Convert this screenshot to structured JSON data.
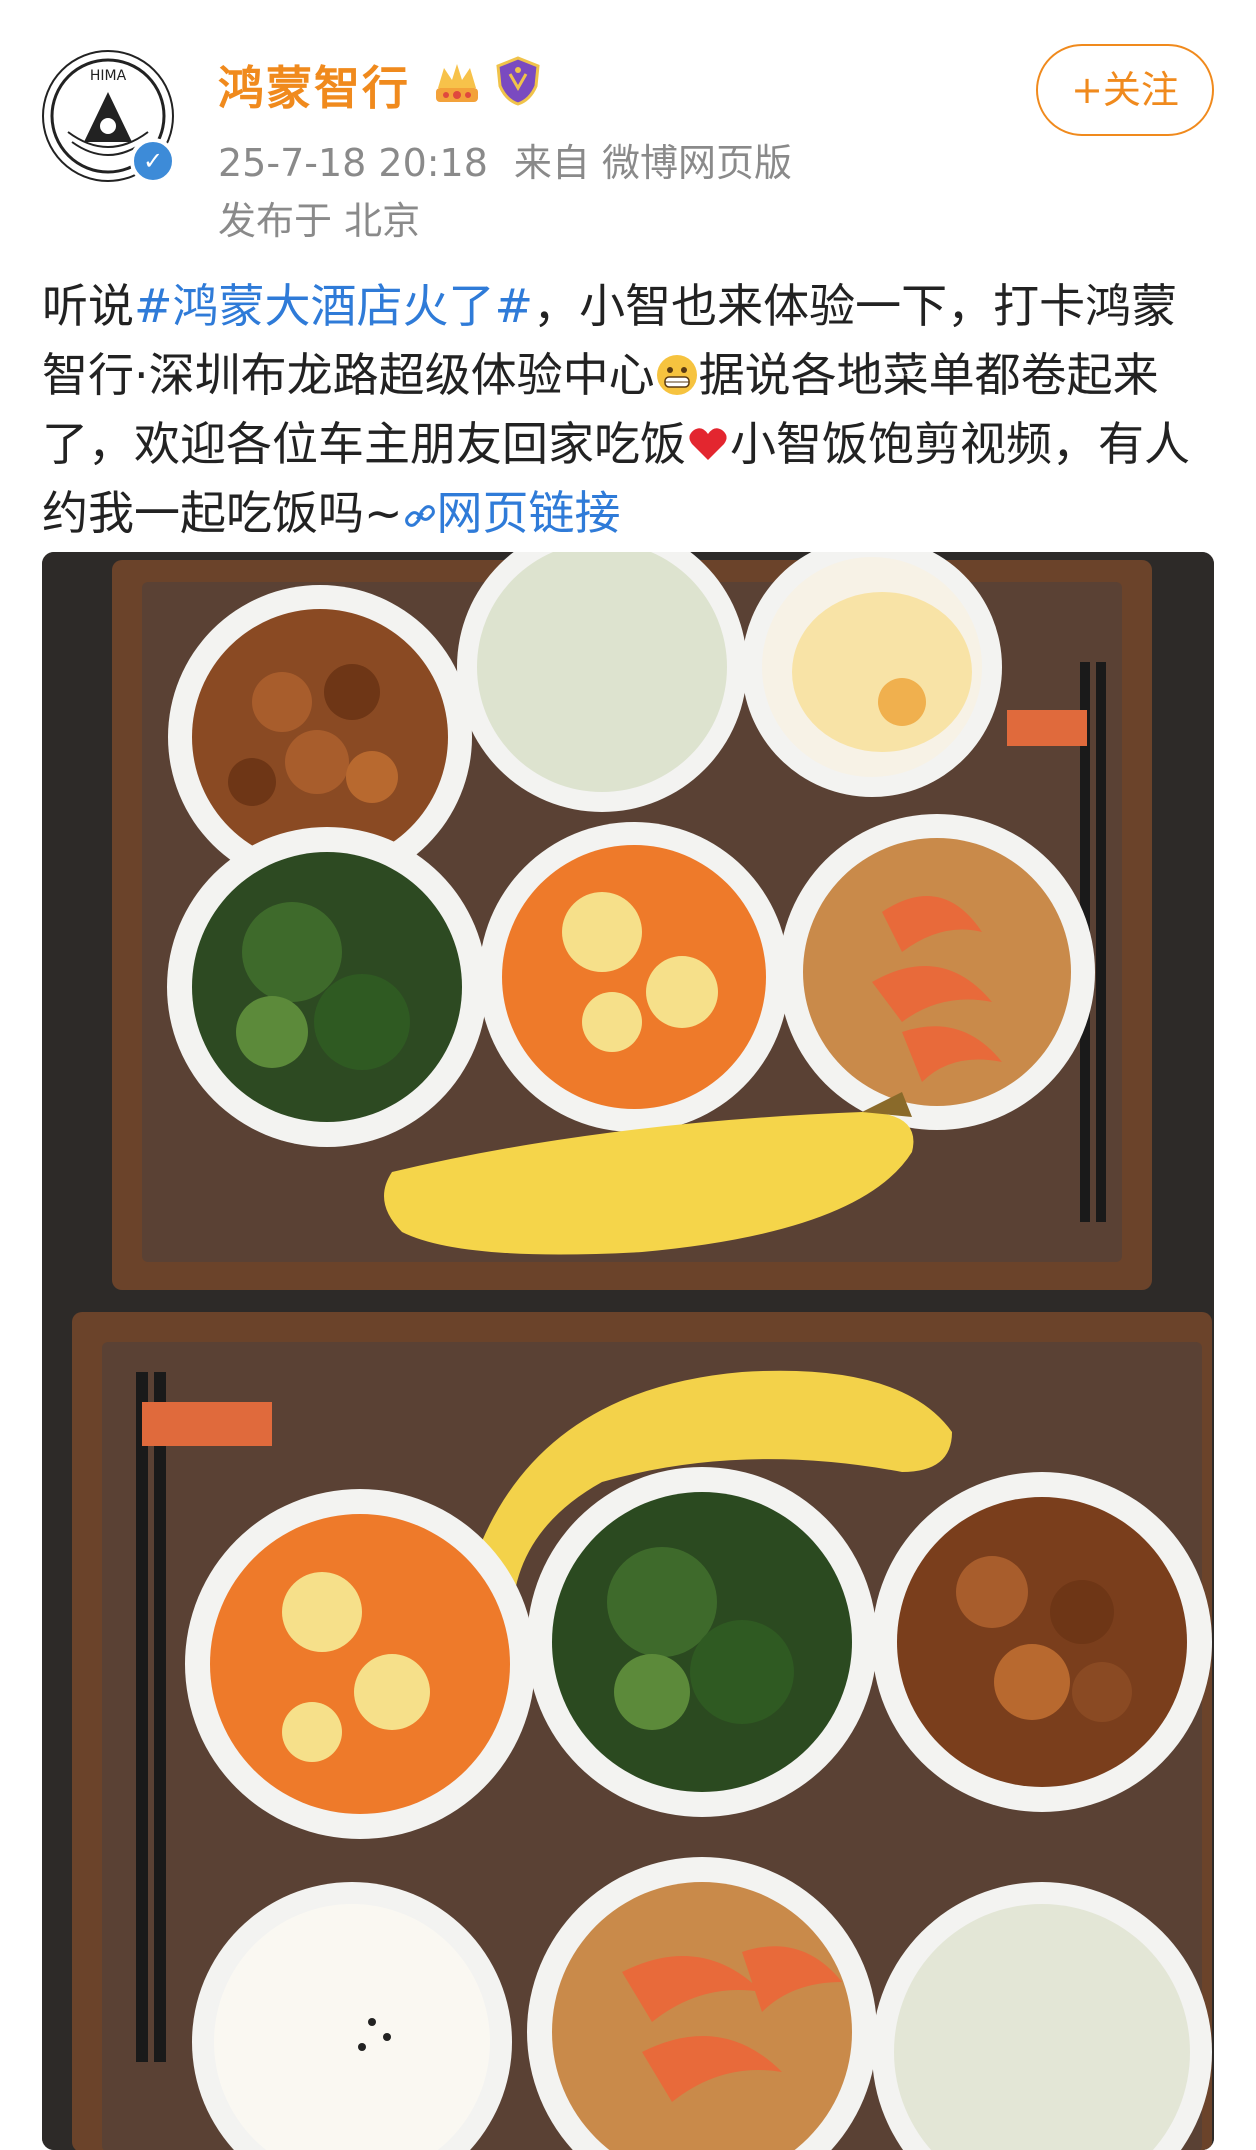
{
  "author": {
    "name": "鸿蒙智行",
    "avatar_text": "HIMA",
    "verified_icon": "verified-check-icon",
    "badges": [
      "crown-badge-icon",
      "shield-badge-icon"
    ]
  },
  "post_meta": {
    "timestamp": "25-7-18 20:18",
    "source": "来自 微博网页版",
    "location": "发布于 北京"
  },
  "follow_button": {
    "label": "+关注"
  },
  "post": {
    "text_1": "听说",
    "topic": "#鸿蒙大酒店火了#",
    "text_2": "，小智也来体验一下，打卡鸿蒙智行·深圳布龙路超级体验中心",
    "text_3": "据说各地菜单都卷起来了，欢迎各位车主朋友回家吃饭",
    "text_4": "小智饭饱剪视频，有人约我一起吃饭吗~",
    "link_label": "网页链接",
    "emojis": [
      "grin-emoji-icon",
      "red-heart-icon"
    ]
  },
  "colors": {
    "brand_orange": "#f08a1d",
    "link_blue": "#2f7bd8",
    "meta_gray": "#8a8a8a",
    "verified_blue": "#3d8bd8"
  }
}
